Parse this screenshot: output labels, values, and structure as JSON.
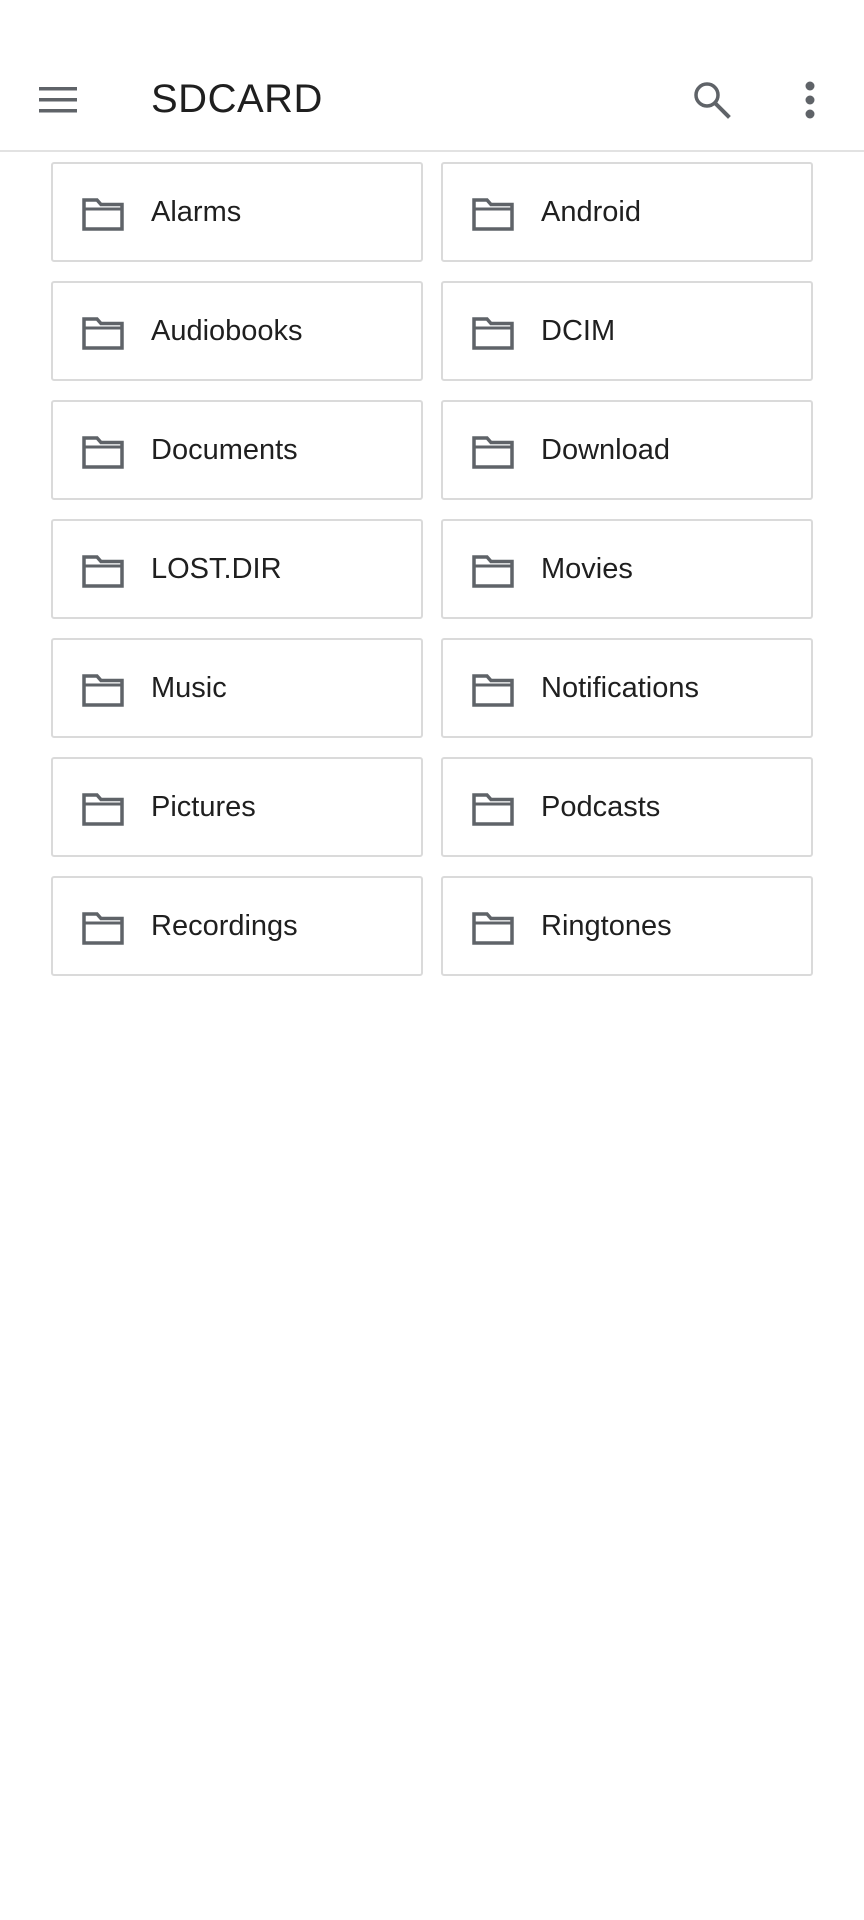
{
  "appbar": {
    "title": "SDCARD",
    "menu_icon": "hamburger-menu-icon",
    "search_icon": "search-icon",
    "more_icon": "more-vertical-icon"
  },
  "colors": {
    "icon": "#5f6368",
    "text": "#1f1f1f",
    "border": "#dadada",
    "divider": "#e2e2e2",
    "background": "#ffffff"
  },
  "folders": [
    {
      "label": "Alarms",
      "icon": "folder-icon"
    },
    {
      "label": "Android",
      "icon": "folder-icon"
    },
    {
      "label": "Audiobooks",
      "icon": "folder-icon"
    },
    {
      "label": "DCIM",
      "icon": "folder-icon"
    },
    {
      "label": "Documents",
      "icon": "folder-icon"
    },
    {
      "label": "Download",
      "icon": "folder-icon"
    },
    {
      "label": "LOST.DIR",
      "icon": "folder-icon"
    },
    {
      "label": "Movies",
      "icon": "folder-icon"
    },
    {
      "label": "Music",
      "icon": "folder-icon"
    },
    {
      "label": "Notifications",
      "icon": "folder-icon"
    },
    {
      "label": "Pictures",
      "icon": "folder-icon"
    },
    {
      "label": "Podcasts",
      "icon": "folder-icon"
    },
    {
      "label": "Recordings",
      "icon": "folder-icon"
    },
    {
      "label": "Ringtones",
      "icon": "folder-icon"
    }
  ]
}
